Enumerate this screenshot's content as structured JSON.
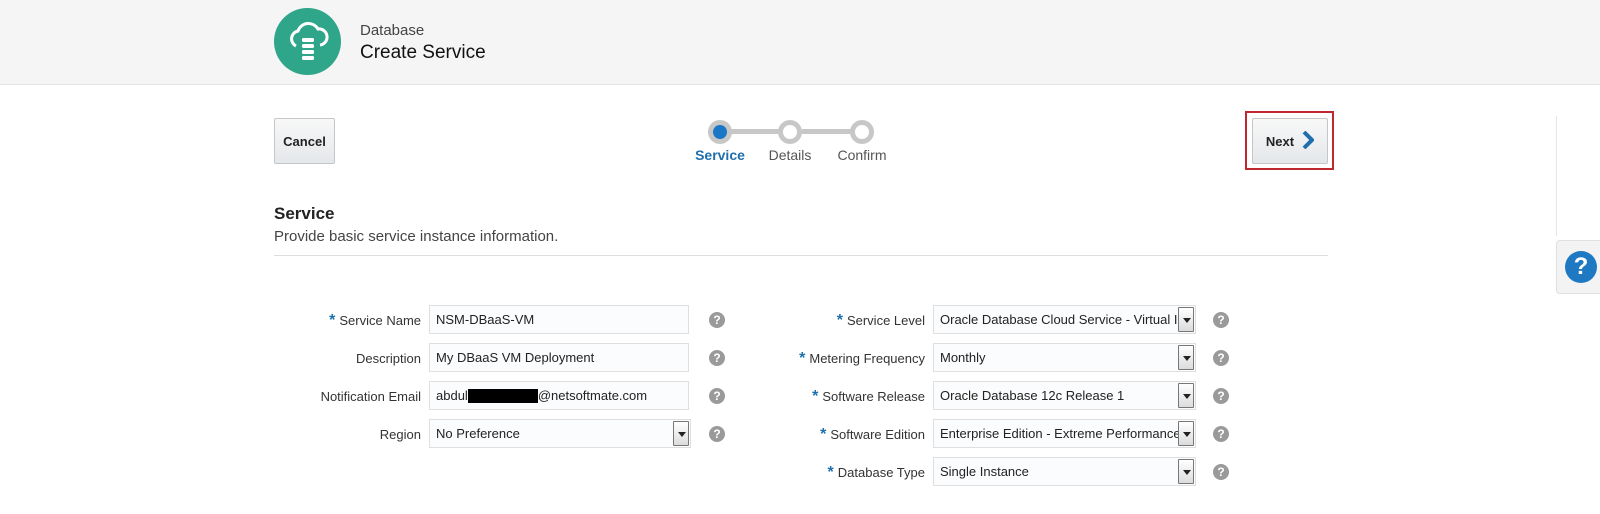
{
  "header": {
    "app_subtitle": "Database",
    "app_title": "Create Service",
    "logo_icon": "cloud-database-icon",
    "logo_color": "#2fa58a"
  },
  "toolbar": {
    "cancel_label": "Cancel",
    "next_label": "Next"
  },
  "train": {
    "steps": [
      {
        "label": "Service",
        "active": true
      },
      {
        "label": "Details",
        "active": false
      },
      {
        "label": "Confirm",
        "active": false
      }
    ],
    "active_color": "#1a76c6"
  },
  "section": {
    "title": "Service",
    "description": "Provide basic service instance information."
  },
  "form": {
    "left": [
      {
        "label": "Service Name",
        "required": true,
        "value": "NSM-DBaaS-VM",
        "type": "text"
      },
      {
        "label": "Description",
        "required": false,
        "value": "My DBaaS VM Deployment",
        "type": "text"
      },
      {
        "label": "Notification Email",
        "required": false,
        "value_prefix": "abdul",
        "value_suffix": "@netsoftmate.com",
        "redacted": true,
        "type": "text"
      },
      {
        "label": "Region",
        "required": false,
        "value": "No Preference",
        "type": "select"
      }
    ],
    "right": [
      {
        "label": "Service Level",
        "required": true,
        "value": "Oracle Database Cloud Service - Virtual Im",
        "type": "select"
      },
      {
        "label": "Metering Frequency",
        "required": true,
        "value": "Monthly",
        "type": "select"
      },
      {
        "label": "Software Release",
        "required": true,
        "value": "Oracle Database 12c Release 1",
        "type": "select"
      },
      {
        "label": "Software Edition",
        "required": true,
        "value": "Enterprise Edition - Extreme Performance",
        "type": "select"
      },
      {
        "label": "Database Type",
        "required": true,
        "value": "Single Instance",
        "type": "select"
      }
    ]
  },
  "help": {
    "glyph": "?",
    "side_glyph": "?"
  }
}
